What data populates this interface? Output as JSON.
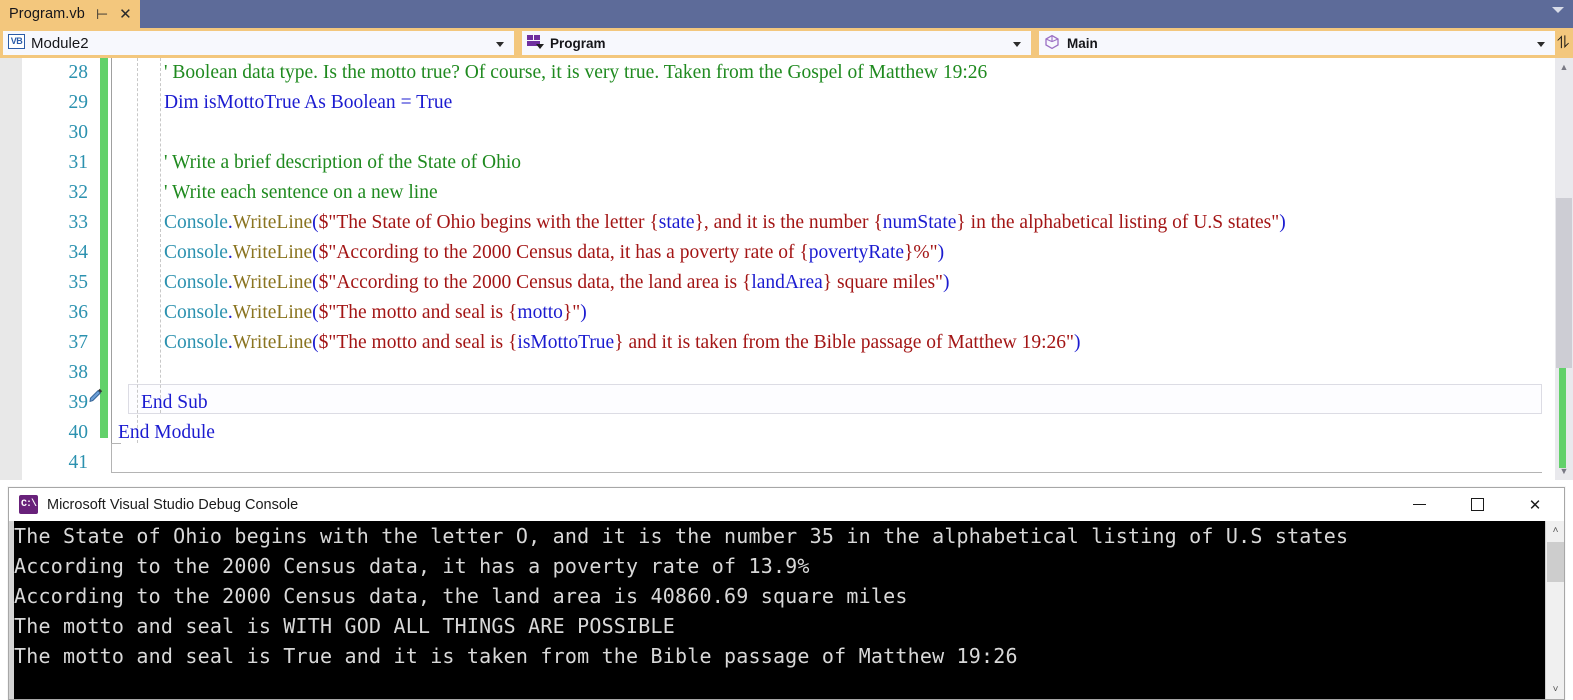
{
  "window": {
    "tab": {
      "title": "Program.vb",
      "pin_icon": "pin-icon",
      "close_icon": "close-icon"
    },
    "tabstrip_overflow_icon": "chevron-down-icon"
  },
  "navbar": {
    "project_combo": {
      "icon": "vb-file-icon",
      "value": "Module2",
      "arrow": "chevron-down-icon"
    },
    "type_combo": {
      "icon": "module-icon",
      "value": "Program",
      "arrow": "chevron-down-icon"
    },
    "member_combo": {
      "icon": "method-cube-icon",
      "value": "Main",
      "arrow": "chevron-down-icon"
    },
    "split_icon": "split-window-icon"
  },
  "editor": {
    "scrollbar": {
      "up_arrow": "▲",
      "down_arrow": "▼"
    },
    "current_line": 37,
    "edit_marker_icon": "pencil-icon",
    "lines": [
      {
        "num": "28",
        "indent": 2,
        "tokens": [
          {
            "t": "' Boolean data type. Is the motto true? Of course, it is very true. Taken from the Gospel of Matthew 19:26",
            "c": "c-com"
          }
        ]
      },
      {
        "num": "29",
        "indent": 2,
        "tokens": [
          {
            "t": "Dim",
            "c": "c-kw"
          },
          {
            "t": " isMottoTrue ",
            "c": "c-plain"
          },
          {
            "t": "As",
            "c": "c-kw"
          },
          {
            "t": " ",
            "c": "c-plain"
          },
          {
            "t": "Boolean",
            "c": "c-kw"
          },
          {
            "t": " = ",
            "c": "c-plain"
          },
          {
            "t": "True",
            "c": "c-kw"
          }
        ]
      },
      {
        "num": "30",
        "indent": 2,
        "tokens": []
      },
      {
        "num": "31",
        "indent": 2,
        "tokens": [
          {
            "t": "' Write a brief description of the State of Ohio",
            "c": "c-com"
          }
        ]
      },
      {
        "num": "32",
        "indent": 2,
        "tokens": [
          {
            "t": "' Write each sentence on a new line",
            "c": "c-com"
          }
        ]
      },
      {
        "num": "33",
        "indent": 2,
        "tokens": [
          {
            "t": "Console",
            "c": "c-type"
          },
          {
            "t": ".",
            "c": "c-plain"
          },
          {
            "t": "WriteLine",
            "c": "c-meth"
          },
          {
            "t": "(",
            "c": "c-plain"
          },
          {
            "t": "$\"The State of Ohio begins with the letter ",
            "c": "c-str"
          },
          {
            "t": "{",
            "c": "c-str"
          },
          {
            "t": "state",
            "c": "c-ident"
          },
          {
            "t": "}",
            "c": "c-str"
          },
          {
            "t": ", and it is the number ",
            "c": "c-str"
          },
          {
            "t": "{",
            "c": "c-str"
          },
          {
            "t": "numState",
            "c": "c-ident"
          },
          {
            "t": "}",
            "c": "c-str"
          },
          {
            "t": " in the alphabetical listing of U.S states\"",
            "c": "c-str"
          },
          {
            "t": ")",
            "c": "c-plain"
          }
        ]
      },
      {
        "num": "34",
        "indent": 2,
        "tokens": [
          {
            "t": "Console",
            "c": "c-type"
          },
          {
            "t": ".",
            "c": "c-plain"
          },
          {
            "t": "WriteLine",
            "c": "c-meth"
          },
          {
            "t": "(",
            "c": "c-plain"
          },
          {
            "t": "$\"According to the 2000 Census data, it has a poverty rate of ",
            "c": "c-str"
          },
          {
            "t": "{",
            "c": "c-str"
          },
          {
            "t": "povertyRate",
            "c": "c-ident"
          },
          {
            "t": "}",
            "c": "c-str"
          },
          {
            "t": "%\"",
            "c": "c-str"
          },
          {
            "t": ")",
            "c": "c-plain"
          }
        ]
      },
      {
        "num": "35",
        "indent": 2,
        "tokens": [
          {
            "t": "Console",
            "c": "c-type"
          },
          {
            "t": ".",
            "c": "c-plain"
          },
          {
            "t": "WriteLine",
            "c": "c-meth"
          },
          {
            "t": "(",
            "c": "c-plain"
          },
          {
            "t": "$\"According to the 2000 Census data, the land area is ",
            "c": "c-str"
          },
          {
            "t": "{",
            "c": "c-str"
          },
          {
            "t": "landArea",
            "c": "c-ident"
          },
          {
            "t": "}",
            "c": "c-str"
          },
          {
            "t": " square miles\"",
            "c": "c-str"
          },
          {
            "t": ")",
            "c": "c-plain"
          }
        ]
      },
      {
        "num": "36",
        "indent": 2,
        "tokens": [
          {
            "t": "Console",
            "c": "c-type"
          },
          {
            "t": ".",
            "c": "c-plain"
          },
          {
            "t": "WriteLine",
            "c": "c-meth"
          },
          {
            "t": "(",
            "c": "c-plain"
          },
          {
            "t": "$\"The motto and seal is ",
            "c": "c-str"
          },
          {
            "t": "{",
            "c": "c-str"
          },
          {
            "t": "motto",
            "c": "c-ident"
          },
          {
            "t": "}",
            "c": "c-str"
          },
          {
            "t": "\"",
            "c": "c-str"
          },
          {
            "t": ")",
            "c": "c-plain"
          }
        ]
      },
      {
        "num": "37",
        "indent": 2,
        "tokens": [
          {
            "t": "Console",
            "c": "c-type"
          },
          {
            "t": ".",
            "c": "c-plain"
          },
          {
            "t": "WriteLine",
            "c": "c-meth"
          },
          {
            "t": "(",
            "c": "c-plain"
          },
          {
            "t": "$\"The motto and seal is ",
            "c": "c-str"
          },
          {
            "t": "{",
            "c": "c-str"
          },
          {
            "t": "isMottoTrue",
            "c": "c-ident"
          },
          {
            "t": "}",
            "c": "c-str"
          },
          {
            "t": " and it is taken from the Bible passage of Matthew 19:26\"",
            "c": "c-str"
          },
          {
            "t": ")",
            "c": "c-plain"
          }
        ]
      },
      {
        "num": "38",
        "indent": 2,
        "tokens": []
      },
      {
        "num": "39",
        "indent": 1,
        "tokens": [
          {
            "t": "End Sub",
            "c": "c-kw"
          }
        ]
      },
      {
        "num": "40",
        "indent": 0,
        "tokens": [
          {
            "t": "End Module",
            "c": "c-kw"
          }
        ]
      },
      {
        "num": "41",
        "indent": 0,
        "tokens": []
      }
    ]
  },
  "console": {
    "icon": "cmd-console-icon",
    "title": "Microsoft Visual Studio Debug Console",
    "buttons": {
      "minimize": "minimize-icon",
      "maximize": "maximize-icon",
      "close": "close-icon"
    },
    "scrollbar": {
      "up_arrow": "˄",
      "down_arrow": "˅"
    },
    "output": [
      "The State of Ohio begins with the letter O, and it is the number 35 in the alphabetical listing of U.S states",
      "According to the 2000 Census data, it has a poverty rate of 13.9%",
      "According to the 2000 Census data, the land area is 40860.69 square miles",
      "The motto and seal is WITH GOD ALL THINGS ARE POSSIBLE",
      "The motto and seal is True and it is taken from the Bible passage of Matthew 19:26"
    ]
  },
  "colors": {
    "tab_active": "#f3c77d",
    "titlebar": "#5d6b99",
    "change_bar": "#62d16a",
    "comment": "#1f8a1f",
    "keyword": "#1b1bd0",
    "type": "#2b91af",
    "method": "#8a7420",
    "string": "#a31515",
    "console_bg": "#000000",
    "console_fg": "#d8d8d8"
  }
}
